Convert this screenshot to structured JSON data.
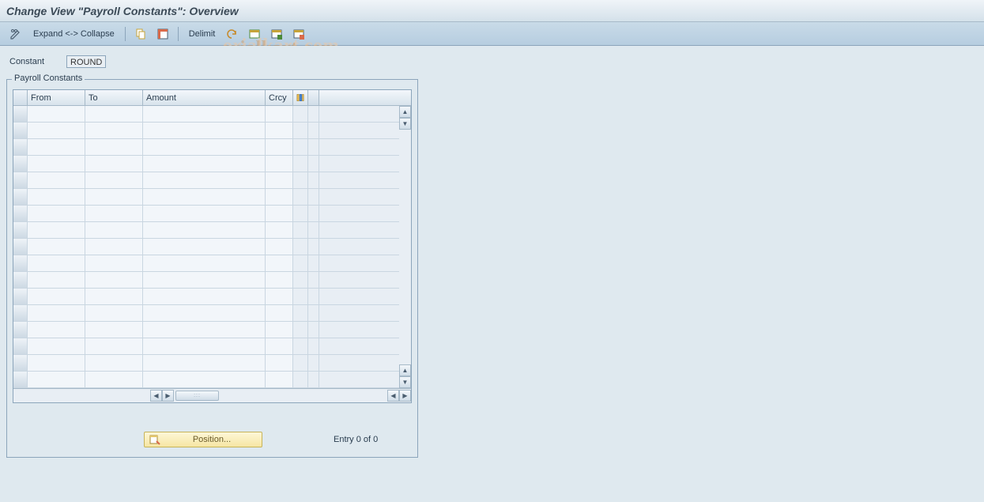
{
  "title": "Change View \"Payroll Constants\": Overview",
  "toolbar": {
    "expand_collapse": "Expand <-> Collapse",
    "delimit": "Delimit"
  },
  "field": {
    "label": "Constant",
    "value": "ROUND"
  },
  "group": {
    "title": "Payroll Constants"
  },
  "table": {
    "columns": {
      "from": "From",
      "to": "To",
      "amount": "Amount",
      "crcy": "Crcy"
    },
    "rows": [
      {
        "from": "",
        "to": "",
        "amount": "",
        "crcy": ""
      },
      {
        "from": "",
        "to": "",
        "amount": "",
        "crcy": ""
      },
      {
        "from": "",
        "to": "",
        "amount": "",
        "crcy": ""
      },
      {
        "from": "",
        "to": "",
        "amount": "",
        "crcy": ""
      },
      {
        "from": "",
        "to": "",
        "amount": "",
        "crcy": ""
      },
      {
        "from": "",
        "to": "",
        "amount": "",
        "crcy": ""
      },
      {
        "from": "",
        "to": "",
        "amount": "",
        "crcy": ""
      },
      {
        "from": "",
        "to": "",
        "amount": "",
        "crcy": ""
      },
      {
        "from": "",
        "to": "",
        "amount": "",
        "crcy": ""
      },
      {
        "from": "",
        "to": "",
        "amount": "",
        "crcy": ""
      },
      {
        "from": "",
        "to": "",
        "amount": "",
        "crcy": ""
      },
      {
        "from": "",
        "to": "",
        "amount": "",
        "crcy": ""
      },
      {
        "from": "",
        "to": "",
        "amount": "",
        "crcy": ""
      },
      {
        "from": "",
        "to": "",
        "amount": "",
        "crcy": ""
      },
      {
        "from": "",
        "to": "",
        "amount": "",
        "crcy": ""
      },
      {
        "from": "",
        "to": "",
        "amount": "",
        "crcy": ""
      },
      {
        "from": "",
        "to": "",
        "amount": "",
        "crcy": ""
      }
    ]
  },
  "footer": {
    "position_label": "Position...",
    "entry_text": "Entry 0 of 0"
  },
  "watermark": "orialkart.com"
}
